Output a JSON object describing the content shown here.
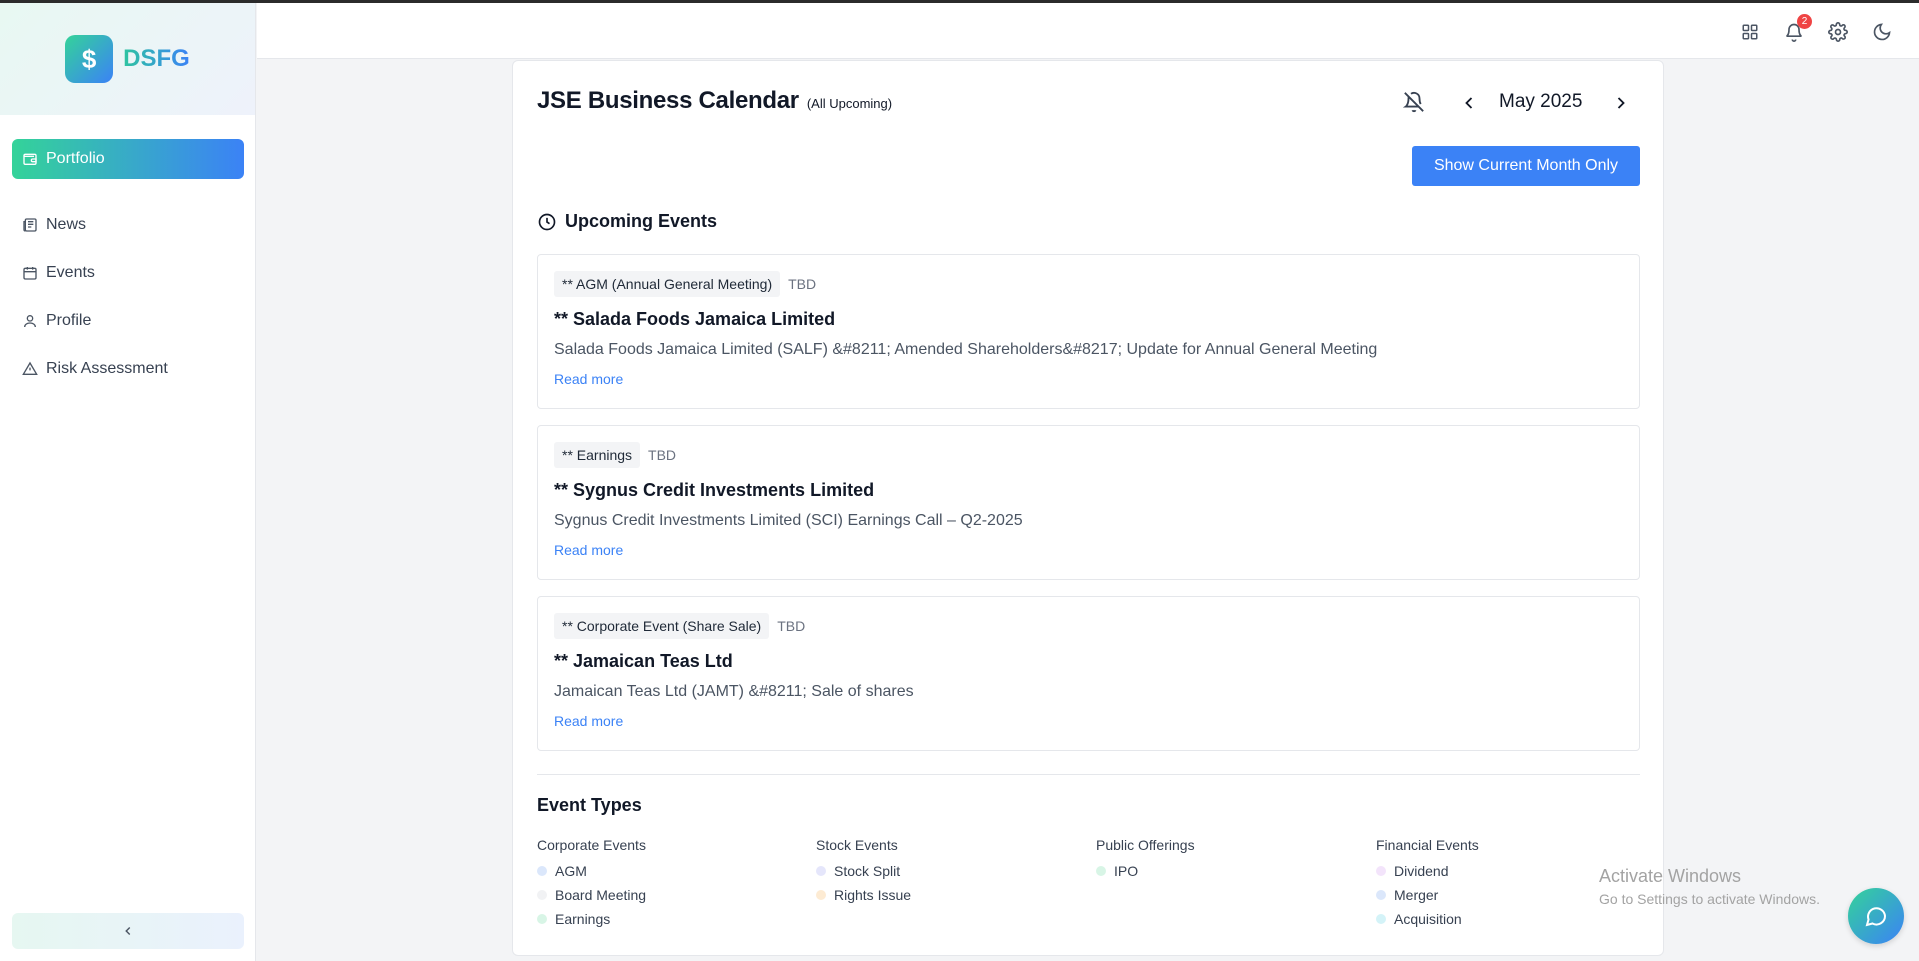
{
  "brand": {
    "logo_symbol": "$",
    "name": "DSFG"
  },
  "sidebar": {
    "active_item": {
      "label": "Portfolio",
      "icon": "wallet-icon"
    },
    "items": [
      {
        "label": "News",
        "icon": "newspaper-icon"
      },
      {
        "label": "Events",
        "icon": "calendar-icon"
      },
      {
        "label": "Profile",
        "icon": "user-icon"
      },
      {
        "label": "Risk Assessment",
        "icon": "warning-icon"
      }
    ],
    "collapse_icon": "chevron-left-icon"
  },
  "header": {
    "notification_count": "2",
    "icons": [
      "grid-icon",
      "bell-icon",
      "gear-icon",
      "moon-icon"
    ]
  },
  "calendar": {
    "title": "JSE Business Calendar",
    "subtitle": "(All Upcoming)",
    "month_label": "May 2025",
    "show_current_button": "Show Current Month Only",
    "section_title": "Upcoming Events"
  },
  "events": [
    {
      "tag": "** AGM (Annual General Meeting)",
      "date": "TBD",
      "title": "** Salada Foods Jamaica Limited",
      "description": "Salada Foods Jamaica Limited (SALF) &#8211; Amended Shareholders&#8217; Update for Annual General Meeting",
      "link": "Read more"
    },
    {
      "tag": "** Earnings",
      "date": "TBD",
      "title": "** Sygnus Credit Investments Limited",
      "description": "Sygnus Credit Investments Limited (SCI) Earnings Call – Q2-2025",
      "link": "Read more"
    },
    {
      "tag": "** Corporate Event (Share Sale)",
      "date": "TBD",
      "title": "** Jamaican Teas Ltd",
      "description": "Jamaican Teas Ltd (JAMT) &#8211; Sale of shares",
      "link": "Read more"
    }
  ],
  "event_types": {
    "title": "Event Types",
    "groups": [
      {
        "name": "Corporate Events",
        "items": [
          {
            "label": "AGM",
            "color": "#dbe7fb"
          },
          {
            "label": "Board Meeting",
            "color": "#f1f2f4"
          },
          {
            "label": "Earnings",
            "color": "#d8f5e6"
          }
        ]
      },
      {
        "name": "Stock Events",
        "items": [
          {
            "label": "Stock Split",
            "color": "#e5e6fb"
          },
          {
            "label": "Rights Issue",
            "color": "#fdebd3"
          }
        ]
      },
      {
        "name": "Public Offerings",
        "items": [
          {
            "label": "IPO",
            "color": "#d8f5e6"
          }
        ]
      },
      {
        "name": "Financial Events",
        "items": [
          {
            "label": "Dividend",
            "color": "#f3e4fb"
          },
          {
            "label": "Merger",
            "color": "#dbe7fb"
          },
          {
            "label": "Acquisition",
            "color": "#d4f3f8"
          }
        ]
      }
    ]
  },
  "watermark": {
    "line1": "Activate Windows",
    "line2": "Go to Settings to activate Windows."
  },
  "chat_icon": "chat-bubble-icon"
}
